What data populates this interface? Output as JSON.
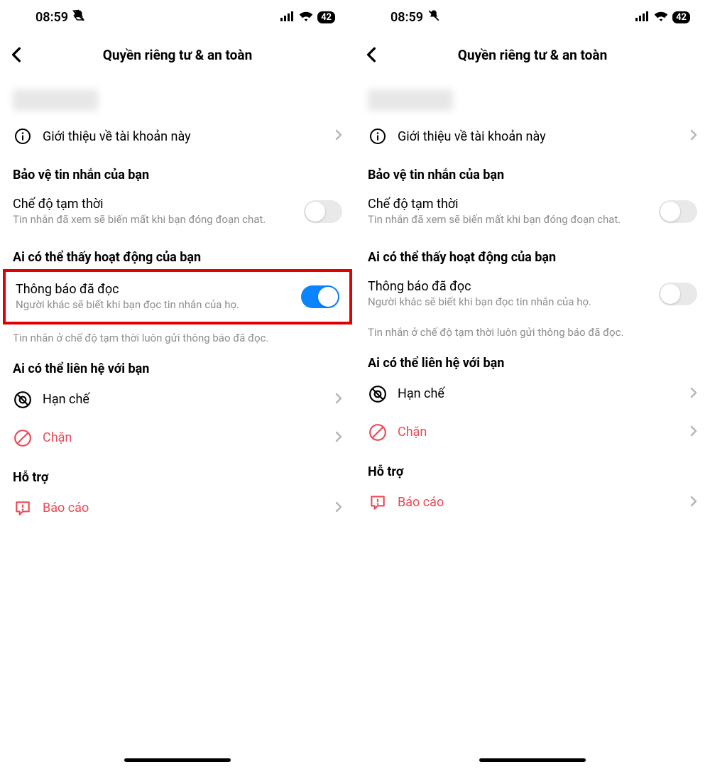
{
  "status": {
    "time": "08:59",
    "battery": "42"
  },
  "nav": {
    "title": "Quyền riêng tư & an toàn"
  },
  "rows": {
    "about_account": "Giới thiệu về tài khoản này",
    "vanish_title": "Chế độ tạm thời",
    "vanish_sub": "Tin nhắn đã xem sẽ biến mất khi bạn đóng đoạn chat.",
    "read_title": "Thông báo đã đọc",
    "read_sub": "Người khác sẽ biết khi bạn đọc tin nhắn của họ.",
    "read_footer": "Tin nhắn ở chế độ tạm thời luôn gửi thông báo đã đọc.",
    "restrict": "Hạn chế",
    "block": "Chặn",
    "report": "Báo cáo"
  },
  "sections": {
    "protect": "Bảo vệ tin nhắn của bạn",
    "activity": "Ai có thể thấy hoạt động của bạn",
    "contact": "Ai có thể liên hệ với bạn",
    "support": "Hỗ trợ"
  },
  "left_panel": {
    "read_receipts_on": true
  },
  "right_panel": {
    "read_receipts_on": false
  }
}
